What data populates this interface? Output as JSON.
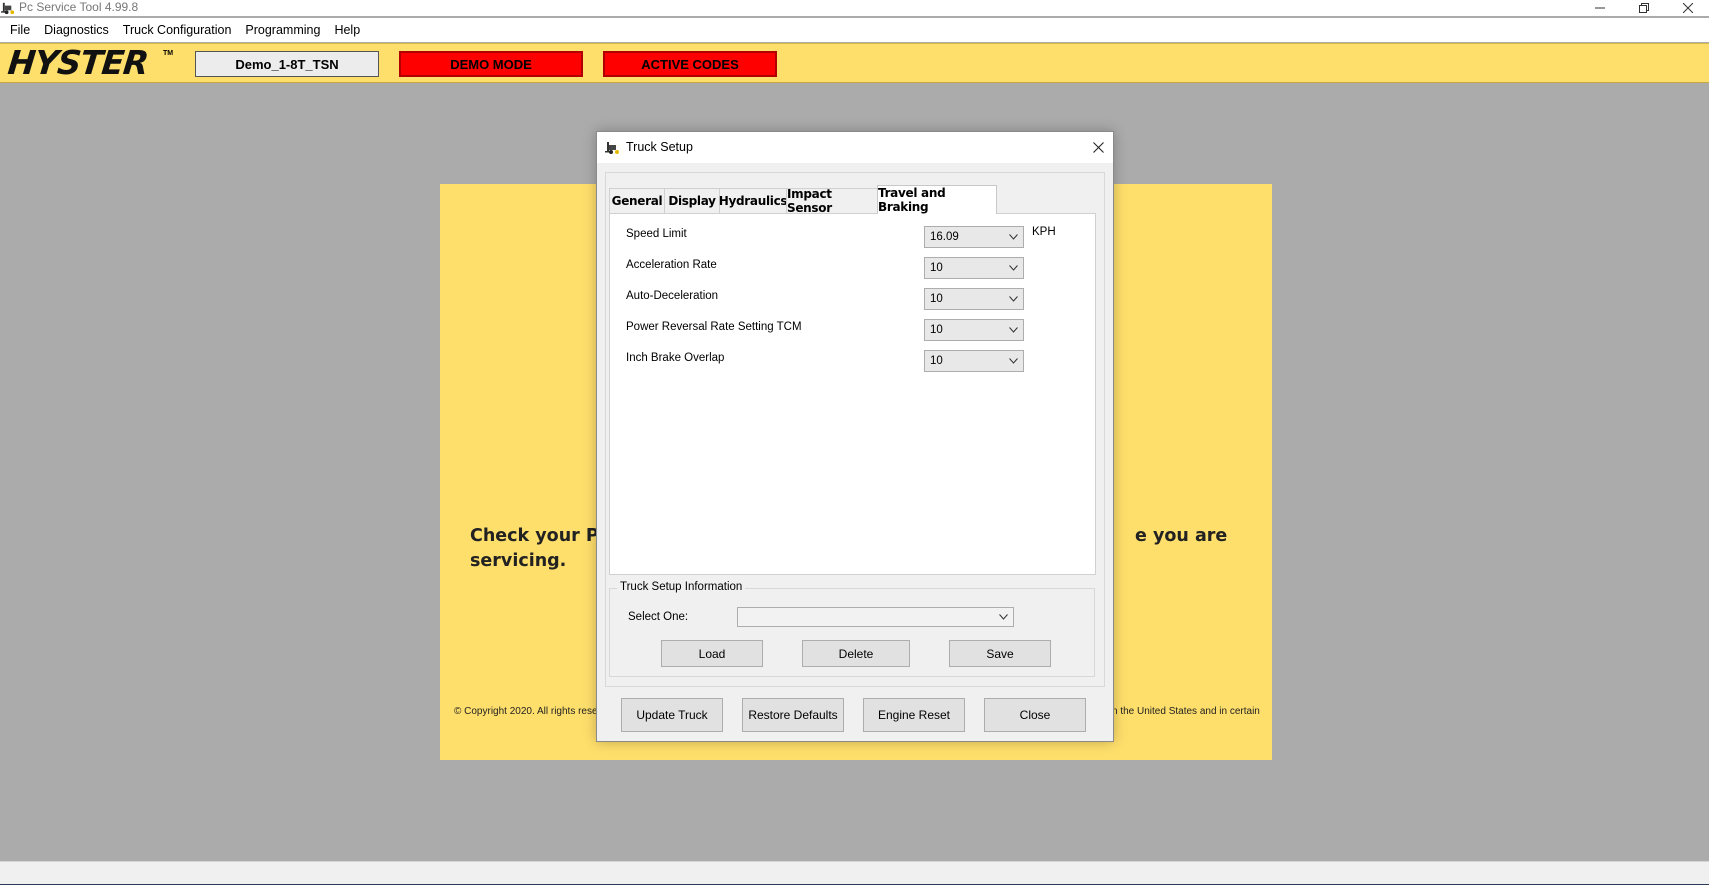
{
  "window": {
    "title": "Pc Service Tool 4.99.8"
  },
  "menu": [
    "File",
    "Diagnostics",
    "Truck Configuration",
    "Programming",
    "Help"
  ],
  "brand_bar": {
    "logo_text": "HYSTER",
    "logo_tm": "TM",
    "truck_name": "Demo_1-8T_TSN",
    "demo_mode": "DEMO MODE",
    "active_codes": "ACTIVE CODES"
  },
  "background": {
    "message_line1_left": "Check your Pa",
    "message_line1_right": "e you are",
    "message_line2": "servicing.",
    "copyright_left": "© Copyright 2020. All rights rese",
    "copyright_right": "n the United States and in certain"
  },
  "dialog": {
    "title": "Truck Setup",
    "tabs": [
      {
        "label": "General",
        "active": false
      },
      {
        "label": "Display",
        "active": false
      },
      {
        "label": "Hydraulics",
        "active": false
      },
      {
        "label": "Impact Sensor",
        "active": false
      },
      {
        "label": "Travel and Braking",
        "active": true
      }
    ],
    "settings": [
      {
        "label": "Speed Limit",
        "value": "16.09",
        "unit": "KPH"
      },
      {
        "label": "Acceleration Rate",
        "value": "10",
        "unit": ""
      },
      {
        "label": "Auto-Deceleration",
        "value": "10",
        "unit": ""
      },
      {
        "label": "Power Reversal Rate Setting TCM",
        "value": "10",
        "unit": ""
      },
      {
        "label": "Inch Brake Overlap",
        "value": "10",
        "unit": ""
      }
    ],
    "info_group": {
      "legend": "Truck Setup Information",
      "select_label": "Select One:",
      "select_value": "",
      "load": "Load",
      "delete": "Delete",
      "save": "Save"
    },
    "buttons": {
      "update_truck": "Update Truck",
      "restore_defaults": "Restore Defaults",
      "engine_reset": "Engine Reset",
      "close": "Close"
    }
  },
  "colors": {
    "brand_yellow": "#ffdf6b",
    "alert_red": "#ff0000",
    "desktop_gray": "#ababab"
  }
}
